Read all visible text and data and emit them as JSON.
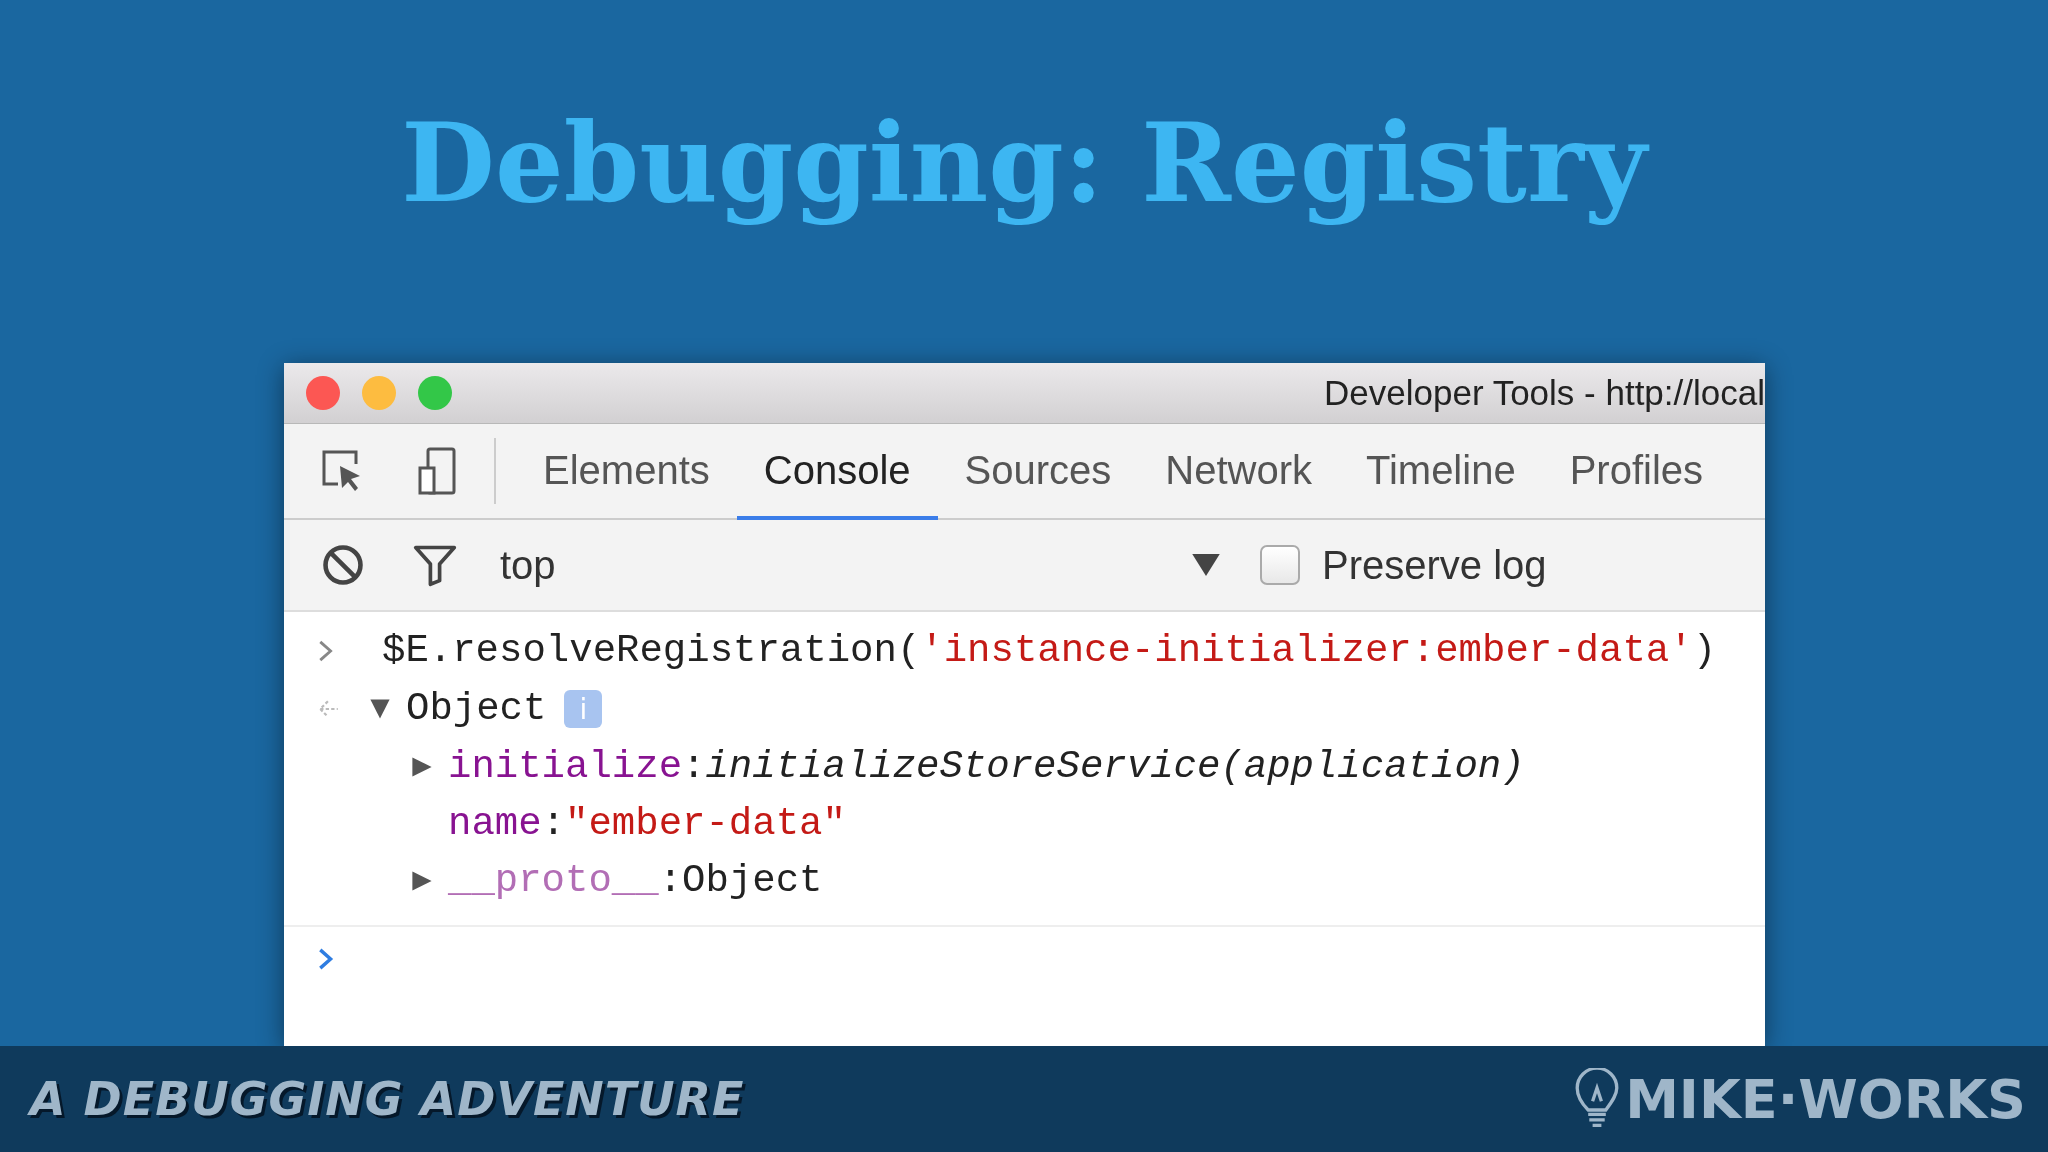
{
  "slide_title": "Debugging: Registry",
  "window": {
    "title": "Developer Tools - http://local"
  },
  "tool_icons": [
    {
      "kind": "inspect"
    },
    {
      "kind": "device"
    }
  ],
  "tabs": [
    {
      "label": "Elements",
      "selected": false
    },
    {
      "label": "Console",
      "selected": true
    },
    {
      "label": "Sources",
      "selected": false
    },
    {
      "label": "Network",
      "selected": false
    },
    {
      "label": "Timeline",
      "selected": false
    },
    {
      "label": "Profiles",
      "selected": false
    }
  ],
  "filter_bar": {
    "context": "top",
    "preserve_log": {
      "label": "Preserve log",
      "checked": false
    }
  },
  "console": [
    {
      "kind": "input",
      "segments": [
        {
          "kind": "code",
          "text": "$E.resolveRegistration("
        },
        {
          "kind": "string",
          "text": "'instance-initializer:ember-data'"
        },
        {
          "kind": "code",
          "text": ")"
        }
      ]
    },
    {
      "kind": "result",
      "label": "Object",
      "expanded": true,
      "info": "i",
      "children": [
        {
          "key": "initialize",
          "separator": ":",
          "value": "initializeStoreService(application)",
          "kind": "function",
          "expandable": true,
          "dim": false
        },
        {
          "key": "name",
          "separator": ":",
          "value": "\"ember-data\"",
          "kind": "string",
          "expandable": false,
          "dim": false
        },
        {
          "key": "__proto__",
          "separator": ":",
          "value": "Object",
          "kind": "plain",
          "expandable": true,
          "dim": true
        }
      ]
    },
    {
      "kind": "prompt"
    }
  ],
  "footer": {
    "series": "A DEBUGGING ADVENTURE",
    "brand": "MIKE·WORKS"
  }
}
